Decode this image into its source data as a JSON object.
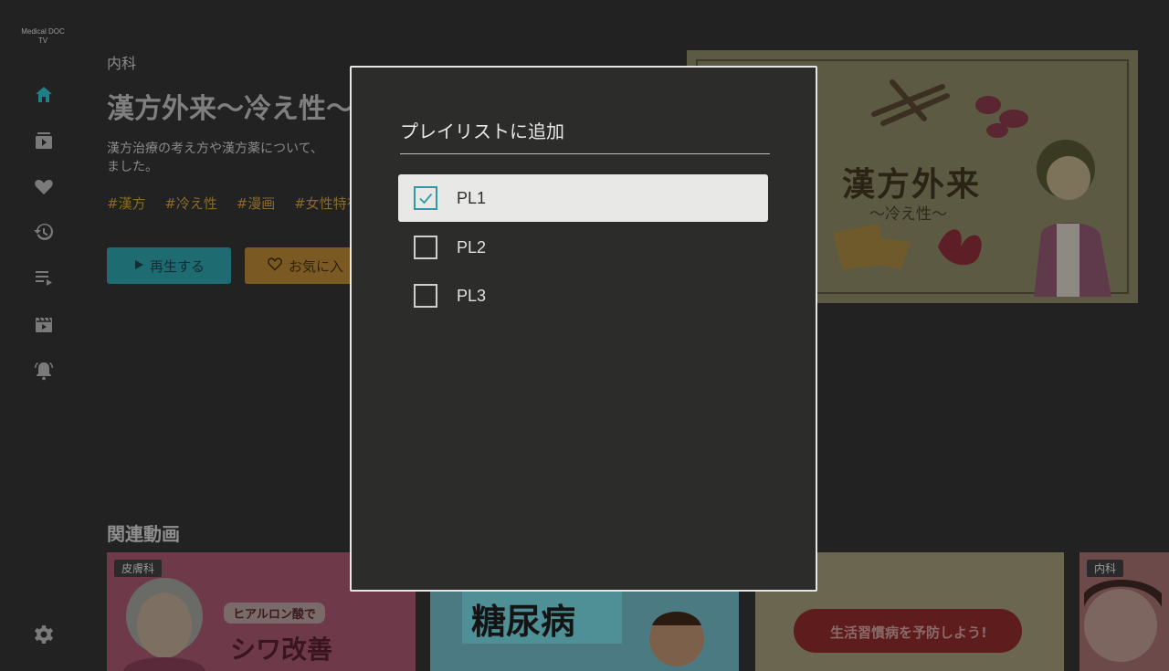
{
  "app": {
    "logo_line1": "Medical DOC",
    "logo_line2": "TV"
  },
  "sidebar": {
    "items": [
      {
        "icon": "home-icon"
      },
      {
        "icon": "library-icon"
      },
      {
        "icon": "heart-icon"
      },
      {
        "icon": "history-icon"
      },
      {
        "icon": "playlist-icon"
      },
      {
        "icon": "video-icon"
      },
      {
        "icon": "bell-icon"
      },
      {
        "icon": "gear-icon"
      }
    ]
  },
  "video": {
    "category": "内科",
    "title": "漢方外来〜冷え性〜",
    "description_line1": "漢方治療の考え方や漢方薬について、",
    "description_line2": "ました。",
    "tags": [
      "#漢方",
      "#冷え性",
      "#漫画",
      "#女性特有"
    ],
    "play_label": "再生する",
    "favorite_label": "お気に入"
  },
  "hero": {
    "title": "漢方外来",
    "subtitle": "〜冷え性〜"
  },
  "related": {
    "heading": "関連動画",
    "items": [
      {
        "badge": "皮膚科",
        "caption1": "ヒアルロン酸で",
        "caption2": "シワ改善"
      },
      {
        "badge": "",
        "caption1": "糖尿病",
        "caption2": ""
      },
      {
        "badge": "",
        "caption1": "生活習慣病を予防しよう!",
        "caption2": ""
      },
      {
        "badge": "内科",
        "caption1": "",
        "caption2": ""
      }
    ]
  },
  "dialog": {
    "title": "プレイリストに追加",
    "playlists": [
      {
        "label": "PL1",
        "checked": true
      },
      {
        "label": "PL2",
        "checked": false
      },
      {
        "label": "PL3",
        "checked": false
      }
    ]
  },
  "colors": {
    "accent": "#2f9aa4",
    "dialog_bg": "#2c2d2b",
    "selected_row": "#e8e8e6"
  }
}
